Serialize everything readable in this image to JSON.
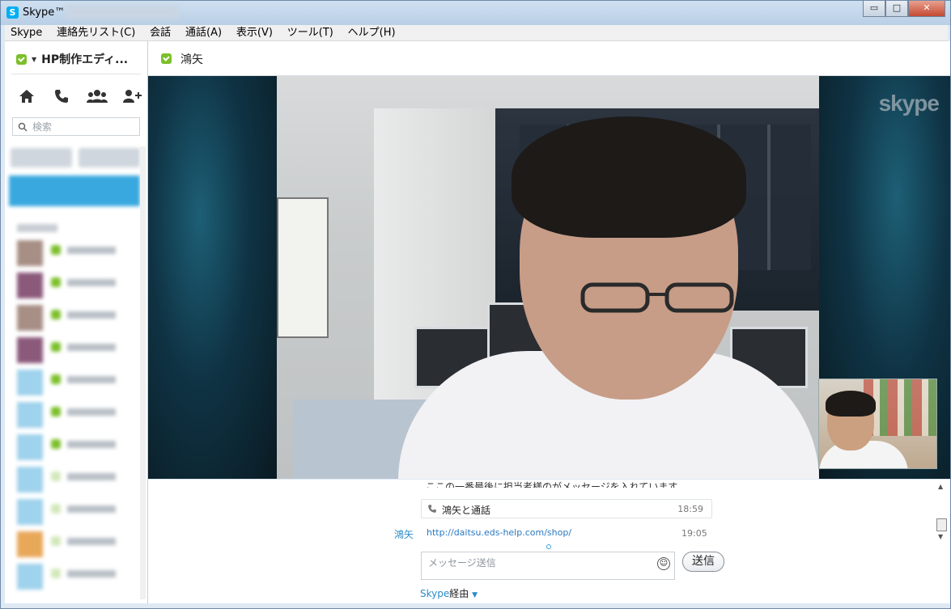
{
  "window": {
    "title": "Skype™",
    "buttons": {
      "minimize": "▭",
      "maximize": "□",
      "close": "✕"
    }
  },
  "menu": [
    "Skype",
    "連絡先リスト(C)",
    "会話",
    "通話(A)",
    "表示(V)",
    "ツール(T)",
    "ヘルプ(H)"
  ],
  "sidebar": {
    "profile_name": "HP制作エディ...",
    "search_placeholder": "検索",
    "nav_icons": [
      "home-icon",
      "phone-icon",
      "group-icon",
      "add-contact-icon"
    ]
  },
  "chat": {
    "contact_name": "鴻矢",
    "video_watermark": "skype",
    "partial_message": "ここの一番最後に担当者様のがメッセージを入れています。",
    "call_entry": {
      "text": "鴻矢と通話",
      "time": "18:59"
    },
    "message": {
      "sender": "鴻矢",
      "link": "http://daitsu.eds-help.com/shop/",
      "time": "19:05"
    },
    "compose_placeholder": "メッセージ送信",
    "send_label": "送信",
    "via_skype": "Skype",
    "via_suffix": "経由",
    "via_caret": "▼"
  },
  "colors": {
    "accent": "#00aff0",
    "status_online": "#7cbf2a",
    "link": "#2a78c0"
  }
}
